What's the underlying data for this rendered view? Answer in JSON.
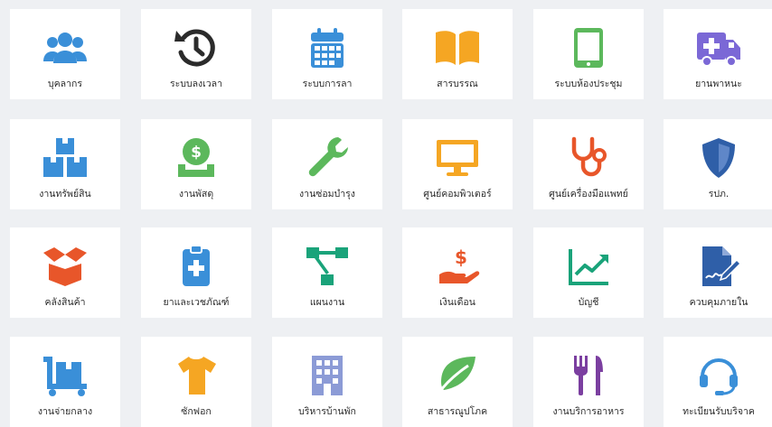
{
  "tiles": [
    {
      "label": "บุคลากร",
      "icon": "users-icon",
      "color": "#3a8fd8"
    },
    {
      "label": "ระบบลงเวลา",
      "icon": "history-icon",
      "color": "#2b2b2b"
    },
    {
      "label": "ระบบการลา",
      "icon": "calendar-icon",
      "color": "#3a8fd8"
    },
    {
      "label": "สารบรรณ",
      "icon": "open-book-icon",
      "color": "#f5a623"
    },
    {
      "label": "ระบบห้องประชุม",
      "icon": "tablet-icon",
      "color": "#5cb85c"
    },
    {
      "label": "ยานพาหนะ",
      "icon": "ambulance-icon",
      "color": "#7b68d6"
    },
    {
      "label": "งานทรัพย์สิน",
      "icon": "boxes-icon",
      "color": "#3a8fd8"
    },
    {
      "label": "งานพัสดุ",
      "icon": "coin-tray-icon",
      "color": "#5cb85c"
    },
    {
      "label": "งานซ่อมบำรุง",
      "icon": "wrench-icon",
      "color": "#5cb85c"
    },
    {
      "label": "ศูนย์คอมพิวเตอร์",
      "icon": "monitor-icon",
      "color": "#f5a623"
    },
    {
      "label": "ศูนย์เครื่องมือแพทย์",
      "icon": "stethoscope-icon",
      "color": "#e8562a"
    },
    {
      "label": "รปภ.",
      "icon": "shield-icon",
      "color": "#2f5fa8"
    },
    {
      "label": "คลังสินค้า",
      "icon": "open-box-icon",
      "color": "#e8562a"
    },
    {
      "label": "ยาและเวชภัณฑ์",
      "icon": "medical-clipboard-icon",
      "color": "#3a8fd8"
    },
    {
      "label": "แผนงาน",
      "icon": "flowchart-icon",
      "color": "#1aa37a"
    },
    {
      "label": "เงินเดือน",
      "icon": "hand-dollar-icon",
      "color": "#e8562a"
    },
    {
      "label": "บัญชี",
      "icon": "chart-line-icon",
      "color": "#1aa37a"
    },
    {
      "label": "ควบคุมภายใน",
      "icon": "signature-icon",
      "color": "#2f5fa8"
    },
    {
      "label": "งานจ่ายกลาง",
      "icon": "dolly-icon",
      "color": "#3a8fd8"
    },
    {
      "label": "ซักฟอก",
      "icon": "tshirt-icon",
      "color": "#f5a623"
    },
    {
      "label": "บริหารบ้านพัก",
      "icon": "building-icon",
      "color": "#8c9bd6"
    },
    {
      "label": "สาธารณูปโภค",
      "icon": "leaf-icon",
      "color": "#5cb85c"
    },
    {
      "label": "งานบริการอาหาร",
      "icon": "utensils-icon",
      "color": "#7b3fa0"
    },
    {
      "label": "ทะเบียนรับบริจาค",
      "icon": "headset-icon",
      "color": "#3a8fd8"
    }
  ]
}
